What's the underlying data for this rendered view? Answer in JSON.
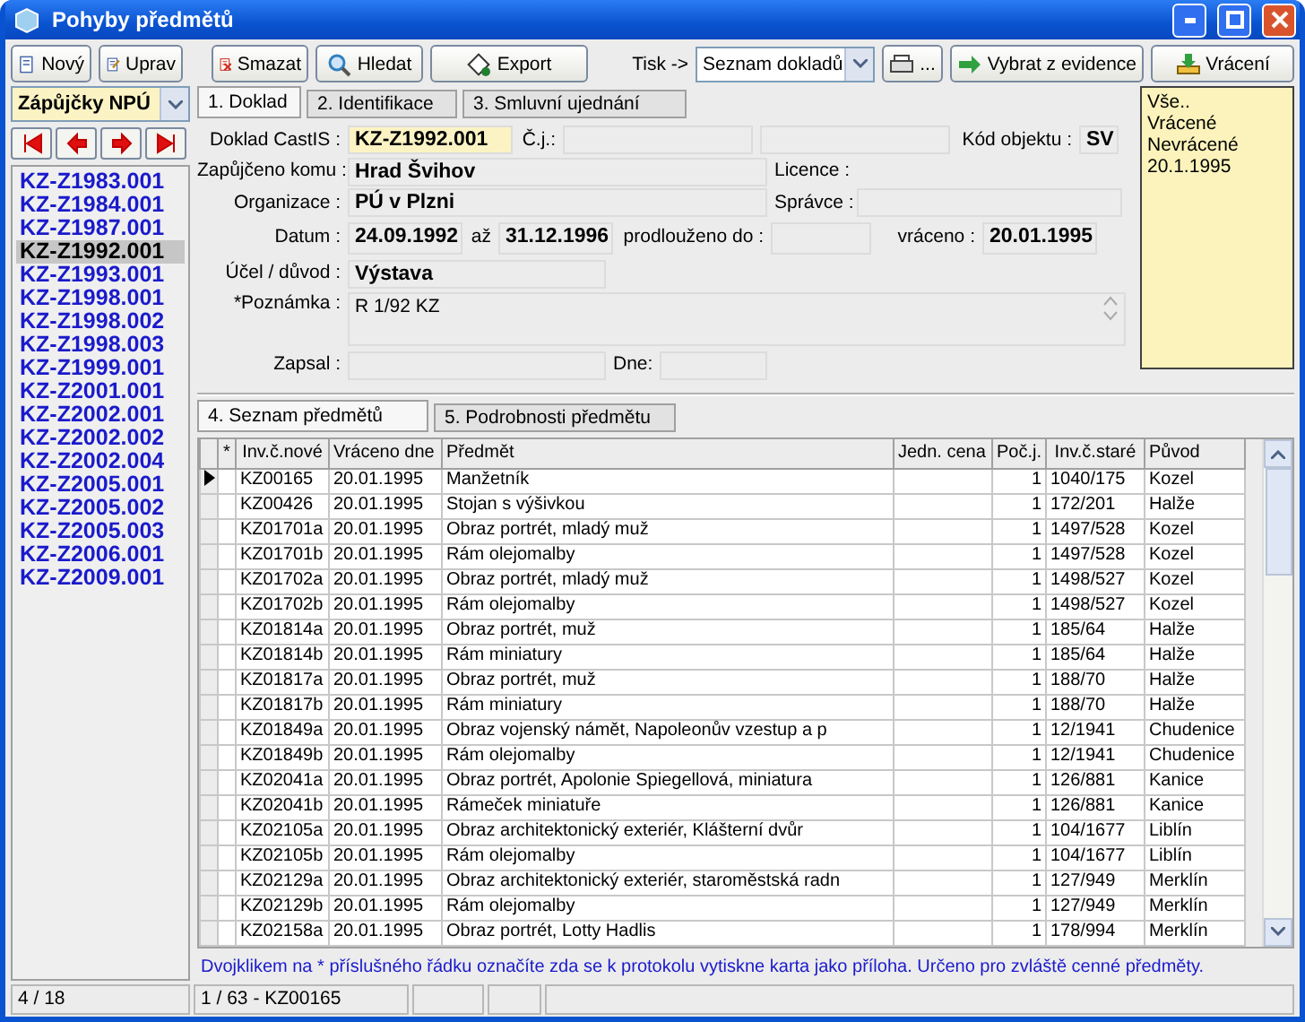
{
  "window": {
    "title": "Pohyby předmětů"
  },
  "toolbar": {
    "buttons": [
      {
        "label": "Nový",
        "kind": "new"
      },
      {
        "label": "Uprav",
        "kind": "edit"
      },
      {
        "label": "Smazat",
        "kind": "delete"
      },
      {
        "label": "Hledat",
        "kind": "search"
      },
      {
        "label": "Export",
        "kind": "export"
      }
    ],
    "print_label": "Tisk ->",
    "print_select": "Seznam dokladů",
    "print_button": "...",
    "select_button": "Vybrat z evidence",
    "return_button": "Vrácení"
  },
  "sidebar": {
    "collection": "Zápůjčky NPÚ",
    "items": [
      {
        "label": "KZ-Z1983.001",
        "selected": false
      },
      {
        "label": "KZ-Z1984.001",
        "selected": false
      },
      {
        "label": "KZ-Z1987.001",
        "selected": false
      },
      {
        "label": "KZ-Z1992.001",
        "selected": true
      },
      {
        "label": "KZ-Z1993.001",
        "selected": false
      },
      {
        "label": "KZ-Z1998.001",
        "selected": false
      },
      {
        "label": "KZ-Z1998.002",
        "selected": false
      },
      {
        "label": "KZ-Z1998.003",
        "selected": false
      },
      {
        "label": "KZ-Z1999.001",
        "selected": false
      },
      {
        "label": "KZ-Z2001.001",
        "selected": false
      },
      {
        "label": "KZ-Z2002.001",
        "selected": false
      },
      {
        "label": "KZ-Z2002.002",
        "selected": false
      },
      {
        "label": "KZ-Z2002.004",
        "selected": false
      },
      {
        "label": "KZ-Z2005.001",
        "selected": false
      },
      {
        "label": "KZ-Z2005.002",
        "selected": false
      },
      {
        "label": "KZ-Z2005.003",
        "selected": false
      },
      {
        "label": "KZ-Z2006.001",
        "selected": false
      },
      {
        "label": "KZ-Z2009.001",
        "selected": false
      }
    ]
  },
  "tabs": [
    {
      "label": "1. Doklad",
      "selected": true
    },
    {
      "label": "2. Identifikace",
      "selected": false
    },
    {
      "label": "3. Smluvní ujednání",
      "selected": false
    }
  ],
  "form": {
    "doc": {
      "label": "Doklad CastIS :",
      "value": "KZ-Z1992.001"
    },
    "ref": {
      "label": "Č.j.:"
    },
    "object_code": {
      "label": "Kód objektu :",
      "value": "SV"
    },
    "lent_to": {
      "label": "Zapůjčeno komu :",
      "value": "Hrad Švihov"
    },
    "licence": {
      "label": "Licence :"
    },
    "organization": {
      "label": "Organizace :",
      "value": "PÚ v Plzni"
    },
    "manager": {
      "label": "Správce :"
    },
    "date_from": {
      "label": "Datum :",
      "value": "24.09.1992"
    },
    "date_to": {
      "label": "až",
      "value": "31.12.1996"
    },
    "extended": {
      "label": "prodlouženo do :"
    },
    "returned": {
      "label": "vráceno :",
      "value": "20.01.1995"
    },
    "purpose": {
      "label": "Účel / důvod :",
      "value": "Výstava"
    },
    "note": {
      "label": "*Poznámka :",
      "value": "R 1/92 KZ"
    },
    "author": {
      "label": "Zapsal :"
    },
    "on_date": {
      "label": "Dne:"
    }
  },
  "filter_list": [
    "Vše..",
    "Vrácené",
    "Nevrácené",
    "20.1.1995"
  ],
  "item_tabs": [
    {
      "label": "4. Seznam předmětů",
      "selected": true
    },
    {
      "label": "5. Podrobnosti předmětu",
      "selected": false
    }
  ],
  "table": {
    "columns": [
      "*",
      "Inv.č.nové",
      "Vráceno dne",
      "Předmět",
      "Jedn. cena",
      "Poč.j.",
      "Inv.č.staré",
      "Původ"
    ],
    "rows": [
      {
        "selected": true,
        "cells": [
          "",
          "KZ00165",
          "20.01.1995",
          "Manžetník",
          "",
          "1",
          "1040/175",
          "Kozel"
        ]
      },
      {
        "selected": false,
        "cells": [
          "",
          "KZ00426",
          "20.01.1995",
          "Stojan s výšivkou",
          "",
          "1",
          "172/201",
          "Halže"
        ]
      },
      {
        "selected": false,
        "cells": [
          "",
          "KZ01701a",
          "20.01.1995",
          "Obraz portrét, mladý muž",
          "",
          "1",
          "1497/528",
          "Kozel"
        ]
      },
      {
        "selected": false,
        "cells": [
          "",
          "KZ01701b",
          "20.01.1995",
          "Rám olejomalby",
          "",
          "1",
          "1497/528",
          "Kozel"
        ]
      },
      {
        "selected": false,
        "cells": [
          "",
          "KZ01702a",
          "20.01.1995",
          "Obraz portrét, mladý muž",
          "",
          "1",
          "1498/527",
          "Kozel"
        ]
      },
      {
        "selected": false,
        "cells": [
          "",
          "KZ01702b",
          "20.01.1995",
          "Rám olejomalby",
          "",
          "1",
          "1498/527",
          "Kozel"
        ]
      },
      {
        "selected": false,
        "cells": [
          "",
          "KZ01814a",
          "20.01.1995",
          "Obraz portrét, muž",
          "",
          "1",
          "185/64",
          "Halže"
        ]
      },
      {
        "selected": false,
        "cells": [
          "",
          "KZ01814b",
          "20.01.1995",
          "Rám miniatury",
          "",
          "1",
          "185/64",
          "Halže"
        ]
      },
      {
        "selected": false,
        "cells": [
          "",
          "KZ01817a",
          "20.01.1995",
          "Obraz portrét, muž",
          "",
          "1",
          "188/70",
          "Halže"
        ]
      },
      {
        "selected": false,
        "cells": [
          "",
          "KZ01817b",
          "20.01.1995",
          "Rám miniatury",
          "",
          "1",
          "188/70",
          "Halže"
        ]
      },
      {
        "selected": false,
        "cells": [
          "",
          "KZ01849a",
          "20.01.1995",
          "Obraz vojenský námět, Napoleonův vzestup a p",
          "",
          "1",
          "12/1941",
          "Chudenice"
        ]
      },
      {
        "selected": false,
        "cells": [
          "",
          "KZ01849b",
          "20.01.1995",
          "Rám olejomalby",
          "",
          "1",
          "12/1941",
          "Chudenice"
        ]
      },
      {
        "selected": false,
        "cells": [
          "",
          "KZ02041a",
          "20.01.1995",
          "Obraz portrét, Apolonie Spiegellová, miniatura",
          "",
          "1",
          "126/881",
          "Kanice"
        ]
      },
      {
        "selected": false,
        "cells": [
          "",
          "KZ02041b",
          "20.01.1995",
          "Rámeček miniatuře",
          "",
          "1",
          "126/881",
          "Kanice"
        ]
      },
      {
        "selected": false,
        "cells": [
          "",
          "KZ02105a",
          "20.01.1995",
          "Obraz architektonický exteriér, Klášterní dvůr",
          "",
          "1",
          "104/1677",
          "Liblín"
        ]
      },
      {
        "selected": false,
        "cells": [
          "",
          "KZ02105b",
          "20.01.1995",
          "Rám olejomalby",
          "",
          "1",
          "104/1677",
          "Liblín"
        ]
      },
      {
        "selected": false,
        "cells": [
          "",
          "KZ02129a",
          "20.01.1995",
          "Obraz architektonický exteriér, staroměstská radn",
          "",
          "1",
          "127/949",
          "Merklín"
        ]
      },
      {
        "selected": false,
        "cells": [
          "",
          "KZ02129b",
          "20.01.1995",
          "Rám olejomalby",
          "",
          "1",
          "127/949",
          "Merklín"
        ]
      },
      {
        "selected": false,
        "cells": [
          "",
          "KZ02158a",
          "20.01.1995",
          "Obraz portrét, Lotty Hadlis",
          "",
          "1",
          "178/994",
          "Merklín"
        ]
      }
    ]
  },
  "hint": "Dvojklikem na * příslušného řádku označíte zda se k protokolu vytiskne karta jako příloha. Určeno pro zvláště cenné předměty.",
  "status_bar": [
    "4 / 18",
    "1 / 63 - KZ00165"
  ]
}
